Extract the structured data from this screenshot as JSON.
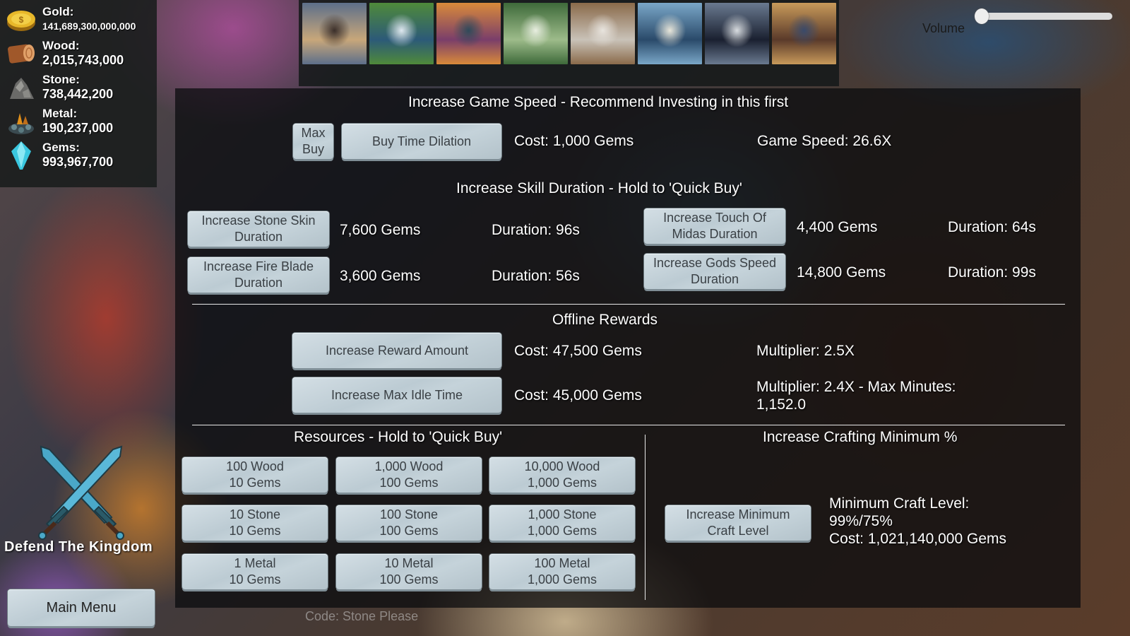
{
  "resources": [
    {
      "label": "Gold:",
      "value": "141,689,300,000,000",
      "icon": "gold-coin-icon"
    },
    {
      "label": "Wood:",
      "value": "2,015,743,000",
      "icon": "wood-log-icon"
    },
    {
      "label": "Stone:",
      "value": "738,442,200",
      "icon": "stone-pile-icon"
    },
    {
      "label": "Metal:",
      "value": "190,237,000",
      "icon": "metal-ore-icon"
    },
    {
      "label": "Gems:",
      "value": "993,967,700",
      "icon": "gem-crystal-icon"
    }
  ],
  "thumbnails": [
    {
      "name": "library-book",
      "colors": [
        "#c8a77a",
        "#5d6f8a",
        "#3b2f2a"
      ]
    },
    {
      "name": "floating-island",
      "colors": [
        "#2c5a78",
        "#4f8a3a",
        "#dfe8f0"
      ]
    },
    {
      "name": "potion-shop",
      "colors": [
        "#7a3e6a",
        "#d98a3a",
        "#2f4a5a"
      ]
    },
    {
      "name": "forest-training-dummy",
      "colors": [
        "#9dbb8a",
        "#3e6a3a",
        "#e8eee0"
      ]
    },
    {
      "name": "monk-library",
      "colors": [
        "#c9c2b8",
        "#8a6a4a",
        "#e8e4de"
      ]
    },
    {
      "name": "stone-portal",
      "colors": [
        "#2a4a6a",
        "#7aa7c8",
        "#e8e6da"
      ]
    },
    {
      "name": "cat-potion-room",
      "colors": [
        "#1a2030",
        "#6a7a90",
        "#d8dce0"
      ]
    },
    {
      "name": "grand-hall",
      "colors": [
        "#5a3a2a",
        "#c89a5a",
        "#3a4a6a"
      ]
    }
  ],
  "volume": {
    "label": "Volume",
    "value": 0
  },
  "game_speed": {
    "title": "Increase Game Speed - Recommend Investing in this first",
    "max_buy_label": "Max\nBuy",
    "buy_label": "Buy Time Dilation",
    "cost": "Cost: 1,000 Gems",
    "speed": "Game Speed: 26.6X"
  },
  "skill_duration": {
    "title": "Increase Skill Duration - Hold to 'Quick Buy'",
    "skills": [
      {
        "button": "Increase Stone Skin\nDuration",
        "cost": "7,600 Gems",
        "duration": "Duration: 96s"
      },
      {
        "button": "Increase Fire Blade\nDuration",
        "cost": "3,600 Gems",
        "duration": "Duration: 56s"
      },
      {
        "button": "Increase Touch Of\nMidas Duration",
        "cost": "4,400 Gems",
        "duration": "Duration: 64s"
      },
      {
        "button": "Increase Gods Speed\nDuration",
        "cost": "14,800 Gems",
        "duration": "Duration: 99s"
      }
    ]
  },
  "offline_rewards": {
    "title": "Offline Rewards",
    "reward_button": "Increase Reward Amount",
    "reward_cost": "Cost: 47,500 Gems",
    "reward_multiplier": "Multiplier: 2.5X",
    "idle_button": "Increase Max Idle Time",
    "idle_cost": "Cost: 45,000 Gems",
    "idle_info": "Multiplier: 2.4X - Max Minutes:\n1,152.0"
  },
  "resource_shop": {
    "title": "Resources - Hold to 'Quick Buy'",
    "buttons": [
      "100 Wood\n10 Gems",
      "1,000 Wood\n100 Gems",
      "10,000 Wood\n1,000 Gems",
      "10 Stone\n10 Gems",
      "100 Stone\n100 Gems",
      "1,000 Stone\n1,000 Gems",
      "1 Metal\n10 Gems",
      "10 Metal\n100 Gems",
      "100 Metal\n1,000 Gems"
    ]
  },
  "crafting": {
    "title": "Increase Crafting Minimum %",
    "button": "Increase Minimum\nCraft Level",
    "info": "Minimum Craft Level:\n99%/75%\nCost: 1,021,140,000 Gems"
  },
  "game_title": "Defend The Kingdom",
  "main_menu_label": "Main Menu",
  "footer_code": "Code: Stone Please"
}
